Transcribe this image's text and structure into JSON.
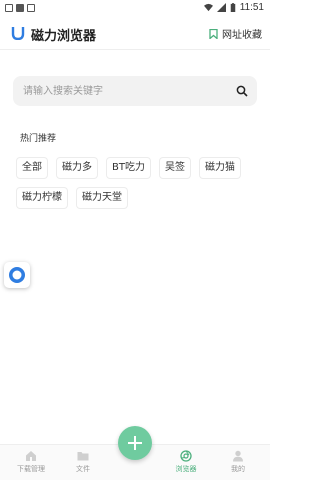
{
  "status_bar": {
    "time": "11:51"
  },
  "header": {
    "title": "磁力浏览器",
    "bookmarks_label": "网址收藏"
  },
  "search": {
    "placeholder": "请输入搜索关键字"
  },
  "hot": {
    "title": "热门推荐",
    "tags": [
      "全部",
      "磁力多",
      "BT吃力",
      "吴签",
      "磁力猫",
      "磁力柠檬",
      "磁力天堂"
    ]
  },
  "nav": {
    "items": [
      {
        "label": "下载管理",
        "icon": "home-icon",
        "active": false
      },
      {
        "label": "文件",
        "icon": "folder-icon",
        "active": false
      },
      {
        "label": "浏览器",
        "icon": "browser-icon",
        "active": true
      },
      {
        "label": "我的",
        "icon": "person-icon",
        "active": false
      }
    ],
    "fab_icon": "plus-icon"
  },
  "colors": {
    "accent": "#6fcb9f",
    "active_nav": "#4caf7d",
    "logo": "#2f7de1"
  }
}
